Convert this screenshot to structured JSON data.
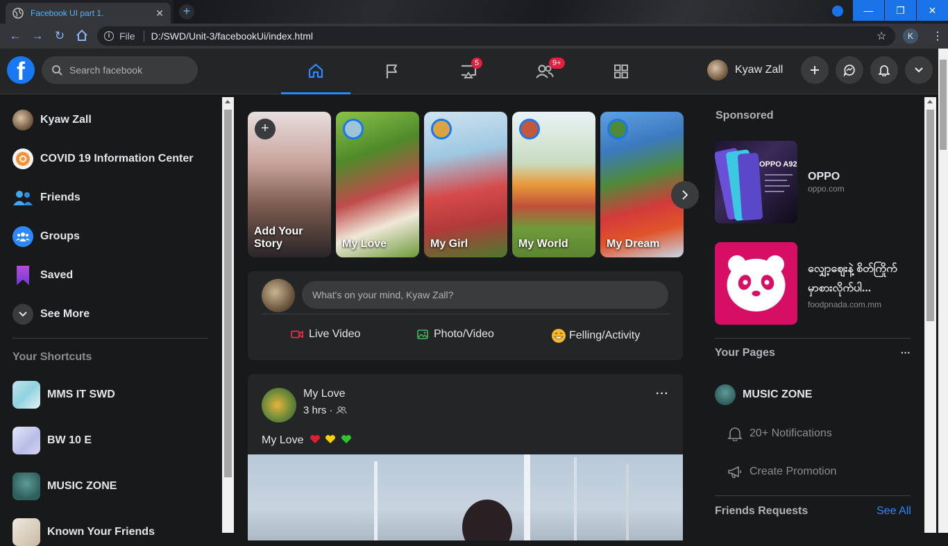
{
  "browser": {
    "tab_title": "Facebook UI part 1.",
    "tab_close": "✕",
    "new_tab": "+",
    "omnibox_prefix": "File",
    "url": "D:/SWD/Unit-3/facebookUi/index.html",
    "profile_initial": "K",
    "win_minimize": "—",
    "win_restore": "❐",
    "win_close": "✕"
  },
  "header": {
    "logo": "f",
    "search_placeholder": "Search facebook",
    "nav_tabs": [
      {
        "name": "home",
        "active": true
      },
      {
        "name": "pages",
        "active": false
      },
      {
        "name": "watch",
        "badge": "5"
      },
      {
        "name": "friends",
        "badge": "9+"
      },
      {
        "name": "menu",
        "active": false
      }
    ],
    "user_name": "Kyaw Zall"
  },
  "sidebar": {
    "items": [
      {
        "label": "Kyaw Zall",
        "icon": "avatar"
      },
      {
        "label": "COVID 19 Information Center",
        "icon": "covid-icon"
      },
      {
        "label": "Friends",
        "icon": "friends-icon"
      },
      {
        "label": "Groups",
        "icon": "groups-icon"
      },
      {
        "label": "Saved",
        "icon": "bookmark-icon"
      },
      {
        "label": "See More",
        "icon": "chevron-down-icon"
      }
    ],
    "shortcuts_heading": "Your Shortcuts",
    "shortcuts": [
      {
        "label": "MMS IT SWD"
      },
      {
        "label": "BW 10 E"
      },
      {
        "label": "MUSIC ZONE"
      },
      {
        "label": "Known Your Friends"
      }
    ]
  },
  "stories": [
    {
      "label": "Add Your Story",
      "line1": "Add Your",
      "line2": "Story"
    },
    {
      "label": "My Love"
    },
    {
      "label": "My Girl"
    },
    {
      "label": "My World"
    },
    {
      "label": "My Dream"
    }
  ],
  "composer": {
    "placeholder": "What's on your mind, Kyaw Zall?",
    "actions": [
      {
        "label": "Live Video",
        "color": "#f02849"
      },
      {
        "label": "Photo/Video",
        "color": "#45bd62"
      },
      {
        "label": "Felling/Activity",
        "color": "#f7b928"
      }
    ]
  },
  "post": {
    "author": "My Love",
    "time": "3 hrs ·",
    "text": "My Love",
    "menu": "···"
  },
  "right": {
    "sponsored_heading": "Sponsored",
    "ads": [
      {
        "name": "OPPO",
        "url": "oppo.com",
        "image_text": "OPPO A92"
      },
      {
        "name": "လျှော့ဈေးနဲ့ စိတ်ကြိုက်",
        "name2": "မှာစားလိုက်ပါ...",
        "url": "foodpnada.com.mm"
      }
    ],
    "pages_heading": "Your Pages",
    "pages_menu": "···",
    "page_name": "MUSIC ZONE",
    "page_notifications": "20+ Notifications",
    "page_promotion": "Create Promotion",
    "friend_requests_heading": "Friends Requests",
    "see_all": "See All"
  }
}
